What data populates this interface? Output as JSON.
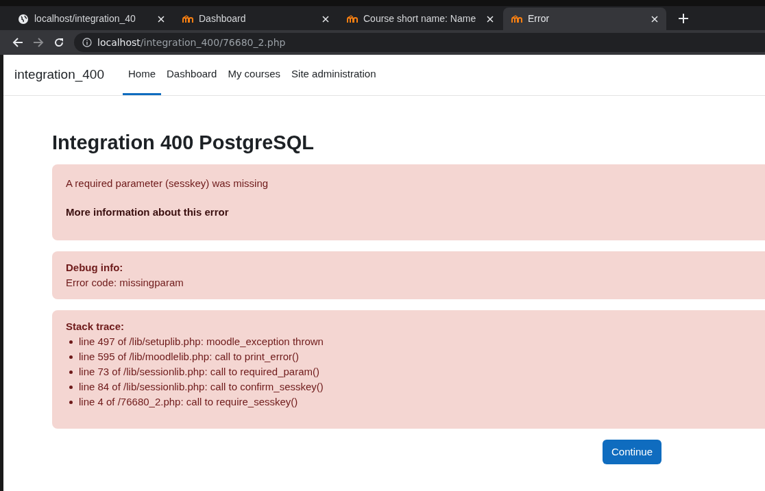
{
  "browser": {
    "tabs": [
      {
        "title": "localhost/integration_40",
        "kind": "globe",
        "selected": false
      },
      {
        "title": "Dashboard",
        "kind": "moodle",
        "selected": false
      },
      {
        "title": "Course short name: Name",
        "kind": "moodle",
        "selected": false
      },
      {
        "title": "Error",
        "kind": "moodle",
        "selected": true
      }
    ],
    "url_host": "localhost",
    "url_path": "/integration_400/76680_2.php"
  },
  "navbar": {
    "brand": "integration_400",
    "items": [
      {
        "label": "Home",
        "selected": true
      },
      {
        "label": "Dashboard",
        "selected": false
      },
      {
        "label": "My courses",
        "selected": false
      },
      {
        "label": "Site administration",
        "selected": false
      }
    ]
  },
  "page": {
    "heading": "Integration 400 PostgreSQL",
    "error_message": "A required parameter (sesskey) was missing",
    "more_info_link": "More information about this error",
    "debug_title": "Debug info:",
    "debug_text": "Error code: missingparam",
    "stack_title": "Stack trace:",
    "stack": [
      "line 497 of /lib/setuplib.php: moodle_exception thrown",
      "line 595 of /lib/moodlelib.php: call to print_error()",
      "line 73 of /lib/sessionlib.php: call to required_param()",
      "line 84 of /lib/sessionlib.php: call to confirm_sesskey()",
      "line 4 of /76680_2.php: call to require_sesskey()"
    ],
    "continue_button": "Continue"
  }
}
